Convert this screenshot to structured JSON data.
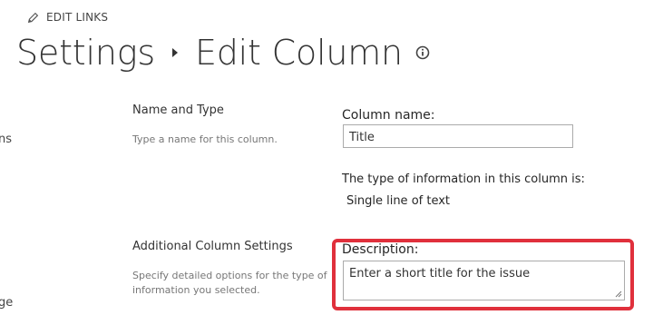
{
  "header": {
    "edit_links_label": "EDIT LINKS",
    "breadcrumb_parent": "Settings",
    "page_title": "Edit Column"
  },
  "left_nav": {
    "fragment_1": "ns",
    "fragment_2": "ge"
  },
  "name_and_type": {
    "heading": "Name and Type",
    "description": "Type a name for this column.",
    "column_name_label": "Column name:",
    "column_name_value": "Title",
    "type_info_label": "The type of information in this column is:",
    "type_value": "Single line of text"
  },
  "additional_settings": {
    "heading": "Additional Column Settings",
    "description_line_1": "Specify detailed options for the type of",
    "description_line_2": "information you selected.",
    "description_field_label": "Description:",
    "description_field_value": "Enter a short title for the issue"
  },
  "colors": {
    "highlight": "#e0303c",
    "input_border": "#ababab"
  }
}
